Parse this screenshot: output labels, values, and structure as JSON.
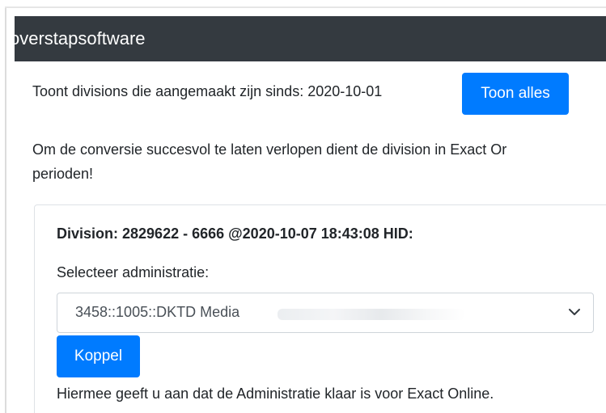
{
  "header": {
    "title": "overstapsoftware"
  },
  "filter": {
    "text": "Toont divisions die aangemaakt zijn sinds: 2020-10-01",
    "show_all_label": "Toon alles"
  },
  "notice": {
    "line1": "Om de conversie succesvol te laten verlopen dient de division in Exact Or",
    "line2": "perioden!"
  },
  "division": {
    "title": "Division: 2829622 - 6666 @2020-10-07 18:43:08 HID:",
    "select_label": "Selecteer administratie:",
    "select_value": "3458::1005::DKTD Media",
    "link_button_label": "Koppel",
    "help_text": "Hiermee geeft u aan dat de Administratie klaar is voor Exact Online."
  },
  "colors": {
    "header_bg": "#343a40",
    "primary": "#007bff"
  },
  "icons": {
    "select_arrow": "chevron-down-icon"
  }
}
